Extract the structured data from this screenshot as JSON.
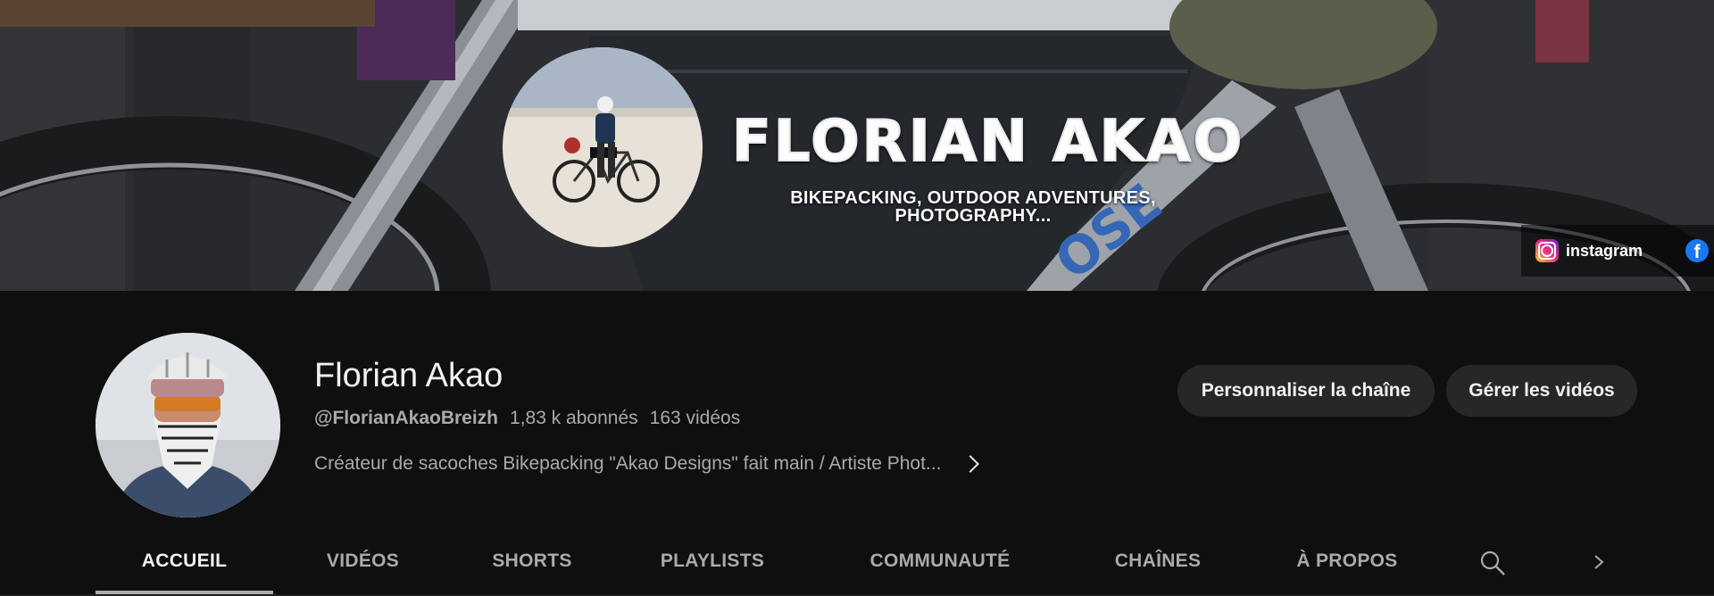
{
  "banner": {
    "title": "FLORIAN AKAO",
    "subtitle_line1": "BIKEPACKING, OUTDOOR ADVENTURES,",
    "subtitle_line2": "PHOTOGRAPHY...",
    "links": [
      {
        "label": "instagram",
        "icon": "instagram-icon"
      },
      {
        "label": "",
        "icon": "facebook-icon"
      }
    ]
  },
  "channel": {
    "name": "Florian Akao",
    "handle": "@FlorianAkaoBreizh",
    "subscribers": "1,83 k abonnés",
    "videos": "163 vidéos",
    "description": "Créateur de sacoches Bikepacking \"Akao Designs\" fait main / Artiste Phot..."
  },
  "actions": {
    "customize": "Personnaliser la chaîne",
    "manage": "Gérer les vidéos"
  },
  "tabs": [
    {
      "label": "ACCUEIL",
      "active": true
    },
    {
      "label": "VIDÉOS"
    },
    {
      "label": "SHORTS"
    },
    {
      "label": "PLAYLISTS"
    },
    {
      "label": "COMMUNAUTÉ"
    },
    {
      "label": "CHAÎNES"
    },
    {
      "label": "À PROPOS"
    }
  ],
  "colors": {
    "background": "#0f0f0f",
    "button_bg": "#272727",
    "text_primary": "#f1f1f1",
    "text_secondary": "#aaaaaa"
  }
}
